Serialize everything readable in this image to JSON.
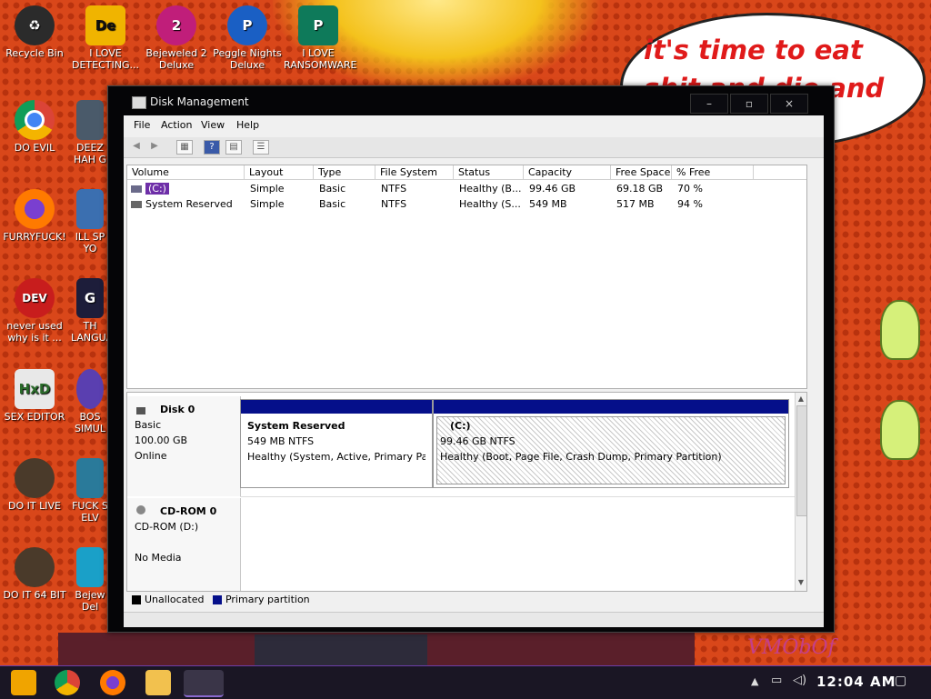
{
  "wallpaper": {
    "speech_text": "it's time to eat shit and die and chew",
    "signature": "VMObOf"
  },
  "desktop_icons": [
    {
      "label": "Recycle Bin",
      "icon": "recycle-bin-icon",
      "color": "#2b2b2b"
    },
    {
      "label": "I LOVE DETECTING...",
      "icon": "de-app-icon",
      "color": "#1b1b1b"
    },
    {
      "label": "Bejeweled 2 Deluxe",
      "icon": "bejeweled-icon",
      "color": "#c01e7a"
    },
    {
      "label": "Peggle Nights Deluxe",
      "icon": "peggle-icon",
      "color": "#1a5fc4"
    },
    {
      "label": "I LOVE RANSOMWARE",
      "icon": "publisher-icon",
      "color": "#0e7a5a"
    },
    {
      "label": "DO EVIL",
      "icon": "chrome-icon",
      "color": "#2a8f3a"
    },
    {
      "label": "DEEZ HAH G",
      "icon": "computer-icon",
      "color": "#4a5a6a"
    },
    {
      "label": "FURRYFUCK!",
      "icon": "firefox-icon",
      "color": "#e66000"
    },
    {
      "label": "ILL SP YO",
      "icon": "network-icon",
      "color": "#3b6fb0"
    },
    {
      "label": "never used why is it ...",
      "icon": "devcpp-icon",
      "color": "#c81d1d"
    },
    {
      "label": "TH LANGUA",
      "icon": "go-icon",
      "color": "#1d1d3a"
    },
    {
      "label": "SEX EDITOR",
      "icon": "hxd-icon",
      "color": "#e8e8e8"
    },
    {
      "label": "BOS SIMUL",
      "icon": "sphere-icon",
      "color": "#5a3fb0"
    },
    {
      "label": "DO IT LIVE",
      "icon": "portrait-icon",
      "color": "#4a3a2a"
    },
    {
      "label": "FUCK S ELV",
      "icon": "app-icon",
      "color": "#2a7a9a"
    },
    {
      "label": "DO IT 64 BIT",
      "icon": "portrait64-icon",
      "color": "#4a3a2a"
    },
    {
      "label": "Bejew Del",
      "icon": "gem-icon",
      "color": "#1aa0c8"
    }
  ],
  "window": {
    "title": "Disk Management",
    "controls": {
      "minimize": "–",
      "maximize": "▫",
      "close": "×"
    },
    "menu": [
      "File",
      "Action",
      "View",
      "Help"
    ]
  },
  "volume_table": {
    "columns": [
      "Volume",
      "Layout",
      "Type",
      "File System",
      "Status",
      "Capacity",
      "Free Space",
      "% Free"
    ],
    "rows": [
      {
        "volume": "(C:)",
        "layout": "Simple",
        "type": "Basic",
        "fs": "NTFS",
        "status": "Healthy (B...",
        "capacity": "99.46 GB",
        "free": "69.18 GB",
        "pct": "70 %"
      },
      {
        "volume": "System Reserved",
        "layout": "Simple",
        "type": "Basic",
        "fs": "NTFS",
        "status": "Healthy (S...",
        "capacity": "549 MB",
        "free": "517 MB",
        "pct": "94 %"
      }
    ]
  },
  "disks": {
    "disk0": {
      "name": "Disk 0",
      "type": "Basic",
      "size": "100.00 GB",
      "state": "Online",
      "p1": {
        "name": "System Reserved",
        "size": "549 MB NTFS",
        "status": "Healthy (System, Active, Primary Pa"
      },
      "p2": {
        "name": "(C:)",
        "size": "99.46 GB NTFS",
        "status": "Healthy (Boot, Page File, Crash Dump, Primary Partition)"
      }
    },
    "cdrom0": {
      "name": "CD-ROM 0",
      "drive": "CD-ROM (D:)",
      "media": "No Media"
    }
  },
  "legend": {
    "unallocated": "Unallocated",
    "primary": "Primary partition",
    "unallocated_color": "#000000",
    "primary_color": "#050f8a"
  },
  "taskbar": {
    "time": "12:04 AM"
  }
}
